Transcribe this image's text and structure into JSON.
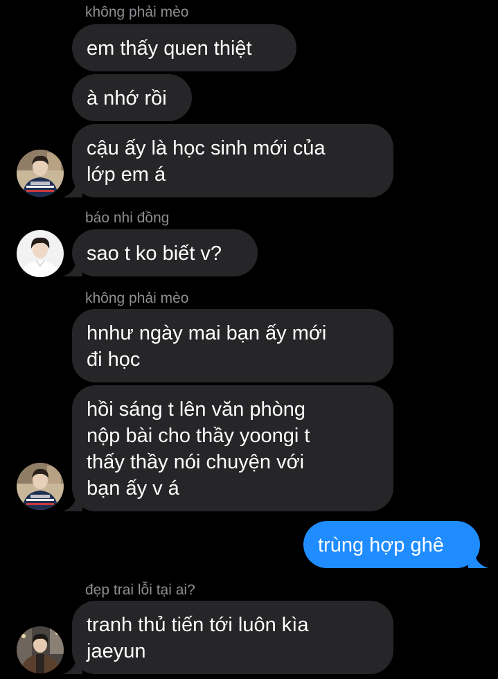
{
  "conversation": {
    "groups": [
      {
        "sender": "không phải mèo",
        "avatar": "avatar-boy-navy-sweater",
        "messages": [
          "em thấy quen thiệt",
          "à nhớ rồi",
          "cậu ấy là học sinh mới của\nlớp em á"
        ]
      },
      {
        "sender": "báo nhi đồng",
        "avatar": "avatar-boy-white-shirt",
        "messages": [
          "sao t ko biết v?"
        ]
      },
      {
        "sender": "không phải mèo",
        "avatar": "avatar-boy-navy-sweater",
        "messages": [
          "hnhư ngày mai bạn ấy mới\nđi học",
          "hồi sáng t lên văn phòng\nnộp bài cho thầy yoongi t\nthấy thầy nói chuyện với\nbạn ấy v á"
        ]
      },
      {
        "sender": "me",
        "messages": [
          "trùng hợp ghê"
        ]
      },
      {
        "sender": "đẹp trai lỗi tại ai?",
        "avatar": "avatar-boy-brown-coat",
        "messages": [
          "tranh thủ tiến tới luôn kìa\njaeyun"
        ]
      }
    ]
  },
  "colors": {
    "background": "#000000",
    "incoming_bubble": "#262628",
    "outgoing_bubble": "#1f8cff",
    "sender_name": "#8e8e93",
    "text": "#ffffff"
  }
}
